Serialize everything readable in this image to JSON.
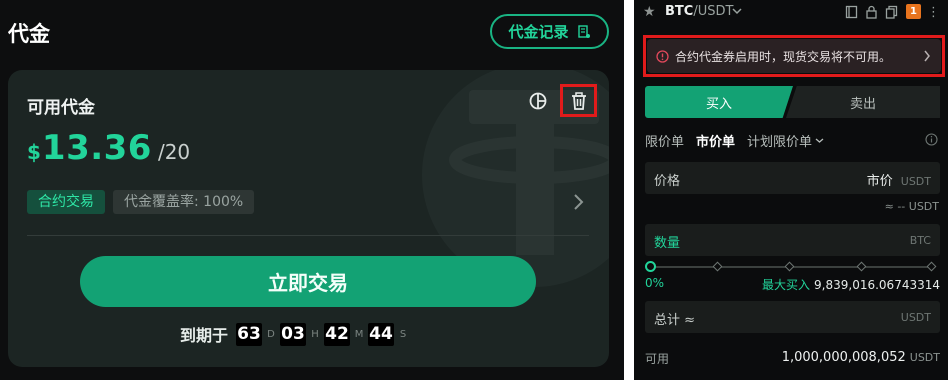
{
  "left": {
    "title": "代金",
    "record_button": "代金记录",
    "card": {
      "label": "可用代金",
      "currency": "$",
      "amount": "13.36",
      "total": "/20",
      "tags": [
        "合约交易",
        "代金覆盖率: 100%"
      ],
      "trade_button": "立即交易",
      "expire_label": "到期于",
      "countdown": [
        {
          "value": "63",
          "unit": "D"
        },
        {
          "value": "03",
          "unit": "H"
        },
        {
          "value": "42",
          "unit": "M"
        },
        {
          "value": "44",
          "unit": "S"
        }
      ]
    }
  },
  "right": {
    "pair_base": "BTC",
    "pair_quote": "/USDT",
    "notification_count": "1",
    "alert_text": "合约代金券启用时，现货交易将不可用。",
    "buy_label": "买入",
    "sell_label": "卖出",
    "order_tabs": [
      "限价单",
      "市价单",
      "计划限价单"
    ],
    "price": {
      "label": "价格",
      "value": "市价",
      "unit": "USDT"
    },
    "approx": "≈ -- USDT",
    "quantity": {
      "label": "数量",
      "unit": "BTC"
    },
    "slider_percent": "0%",
    "max_buy": {
      "label": "最大买入",
      "value": "9,839,016.06743314"
    },
    "total": {
      "label": "总计 ≈",
      "unit": "USDT"
    },
    "available": {
      "label": "可用",
      "value": "1,000,000,008,052",
      "unit": "USDT"
    }
  },
  "colors": {
    "accent_green": "#22d49a",
    "button_green": "#13a274",
    "highlight_red": "#e11b1b",
    "badge_orange": "#e8741e"
  },
  "icons": [
    "receipt-icon",
    "pie-chart-icon",
    "trash-icon",
    "chevron-right-icon",
    "star-icon",
    "chevron-down-icon",
    "book-icon",
    "lock-icon",
    "copy-icon",
    "alert-circle-icon",
    "info-icon"
  ]
}
